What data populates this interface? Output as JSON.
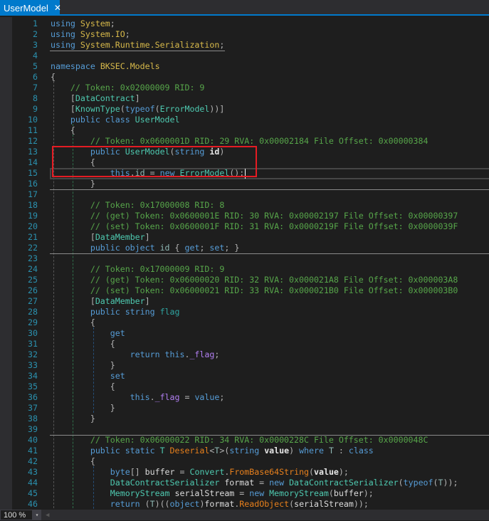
{
  "tab": {
    "title": "UserModel",
    "close": "✕"
  },
  "status": {
    "zoom": "100 %",
    "dropdown": "▾",
    "scroll_left": "◀"
  },
  "colors": {
    "accent": "#007acc",
    "highlight_box": "#e51c23"
  },
  "lines": [
    [
      [
        "kw",
        "using"
      ],
      [
        "lo",
        " "
      ],
      [
        "ns",
        "System"
      ],
      [
        "p",
        ";"
      ]
    ],
    [
      [
        "kw",
        "using"
      ],
      [
        "lo",
        " "
      ],
      [
        "ns",
        "System.IO"
      ],
      [
        "p",
        ";"
      ]
    ],
    [
      [
        "kw",
        "using"
      ],
      [
        "lo",
        " "
      ],
      [
        "ns",
        "System.Runtime.Serialization"
      ],
      [
        "p",
        ";"
      ]
    ],
    [],
    [
      [
        "kw",
        "namespace"
      ],
      [
        "lo",
        " "
      ],
      [
        "ns",
        "BKSEC.Models"
      ]
    ],
    [
      [
        "p",
        "{"
      ]
    ],
    [
      [
        "cm",
        "    // Token: 0x02000009 RID: 9"
      ]
    ],
    [
      [
        "p",
        "    ["
      ],
      [
        "ty",
        "DataContract"
      ],
      [
        "p",
        "]"
      ]
    ],
    [
      [
        "p",
        "    ["
      ],
      [
        "ty",
        "KnownType"
      ],
      [
        "p",
        "("
      ],
      [
        "kw",
        "typeof"
      ],
      [
        "p",
        "("
      ],
      [
        "ty",
        "ErrorModel"
      ],
      [
        "p",
        "))]"
      ]
    ],
    [
      [
        "kw",
        "    public class "
      ],
      [
        "ty",
        "UserModel"
      ]
    ],
    [
      [
        "p",
        "    {"
      ]
    ],
    [
      [
        "cm",
        "        // Token: 0x0600001D RID: 29 RVA: 0x00002184 File Offset: 0x00000384"
      ]
    ],
    [
      [
        "kw",
        "        public "
      ],
      [
        "ty",
        "UserModel"
      ],
      [
        "p",
        "("
      ],
      [
        "kw",
        "string "
      ],
      [
        "pa",
        "id"
      ],
      [
        "p",
        ")"
      ]
    ],
    [
      [
        "p",
        "        {"
      ]
    ],
    [
      [
        "kw",
        "            this"
      ],
      [
        "p",
        "."
      ],
      [
        "pr",
        "id"
      ],
      [
        "p",
        " = "
      ],
      [
        "kw",
        "new "
      ],
      [
        "ty",
        "ErrorModel"
      ],
      [
        "p",
        "();"
      ]
    ],
    [
      [
        "p",
        "        }"
      ]
    ],
    [],
    [
      [
        "cm",
        "        // Token: 0x17000008 RID: 8"
      ]
    ],
    [
      [
        "cm",
        "        // (get) Token: 0x0600001E RID: 30 RVA: 0x00002197 File Offset: 0x00000397"
      ]
    ],
    [
      [
        "cm",
        "        // (set) Token: 0x0600001F RID: 31 RVA: 0x0000219F File Offset: 0x0000039F"
      ]
    ],
    [
      [
        "p",
        "        ["
      ],
      [
        "ty",
        "DataMember"
      ],
      [
        "p",
        "]"
      ]
    ],
    [
      [
        "kw",
        "        public object "
      ],
      [
        "pr",
        "id"
      ],
      [
        "p",
        " { "
      ],
      [
        "kw",
        "get"
      ],
      [
        "p",
        "; "
      ],
      [
        "kw",
        "set"
      ],
      [
        "p",
        "; }"
      ]
    ],
    [],
    [
      [
        "cm",
        "        // Token: 0x17000009 RID: 9"
      ]
    ],
    [
      [
        "cm",
        "        // (get) Token: 0x06000020 RID: 32 RVA: 0x000021A8 File Offset: 0x000003A8"
      ]
    ],
    [
      [
        "cm",
        "        // (set) Token: 0x06000021 RID: 33 RVA: 0x000021B0 File Offset: 0x000003B0"
      ]
    ],
    [
      [
        "p",
        "        ["
      ],
      [
        "ty",
        "DataMember"
      ],
      [
        "p",
        "]"
      ]
    ],
    [
      [
        "kw",
        "        public string "
      ],
      [
        "pf",
        "flag"
      ]
    ],
    [
      [
        "p",
        "        {"
      ]
    ],
    [
      [
        "kw",
        "            get"
      ]
    ],
    [
      [
        "p",
        "            {"
      ]
    ],
    [
      [
        "kw",
        "                return this"
      ],
      [
        "p",
        "."
      ],
      [
        "fi",
        "_flag"
      ],
      [
        "p",
        ";"
      ]
    ],
    [
      [
        "p",
        "            }"
      ]
    ],
    [
      [
        "kw",
        "            set"
      ]
    ],
    [
      [
        "p",
        "            {"
      ]
    ],
    [
      [
        "kw",
        "                this"
      ],
      [
        "p",
        "."
      ],
      [
        "fi",
        "_flag"
      ],
      [
        "p",
        " = "
      ],
      [
        "kw",
        "value"
      ],
      [
        "p",
        ";"
      ]
    ],
    [
      [
        "p",
        "            }"
      ]
    ],
    [
      [
        "p",
        "        }"
      ]
    ],
    [],
    [
      [
        "cm",
        "        // Token: 0x06000022 RID: 34 RVA: 0x0000228C File Offset: 0x0000048C"
      ]
    ],
    [
      [
        "kw",
        "        public static "
      ],
      [
        "ty",
        "T "
      ],
      [
        "me",
        "Deserial"
      ],
      [
        "p",
        "<"
      ],
      [
        "gp",
        "T"
      ],
      [
        "p",
        ">("
      ],
      [
        "kw",
        "string "
      ],
      [
        "pa",
        "value"
      ],
      [
        "p",
        ") "
      ],
      [
        "kw",
        "where "
      ],
      [
        "gp",
        "T"
      ],
      [
        "p",
        " : "
      ],
      [
        "kw",
        "class"
      ]
    ],
    [
      [
        "p",
        "        {"
      ]
    ],
    [
      [
        "kw",
        "            byte"
      ],
      [
        "p",
        "[] "
      ],
      [
        "lo",
        "buffer"
      ],
      [
        "p",
        " = "
      ],
      [
        "ty",
        "Convert"
      ],
      [
        "p",
        "."
      ],
      [
        "me",
        "FromBase64String"
      ],
      [
        "p",
        "("
      ],
      [
        "pa",
        "value"
      ],
      [
        "p",
        ");"
      ]
    ],
    [
      [
        "ty",
        "            DataContractSerializer "
      ],
      [
        "lo",
        "format"
      ],
      [
        "p",
        " = "
      ],
      [
        "kw",
        "new "
      ],
      [
        "ty",
        "DataContractSerializer"
      ],
      [
        "p",
        "("
      ],
      [
        "kw",
        "typeof"
      ],
      [
        "p",
        "("
      ],
      [
        "gp",
        "T"
      ],
      [
        "p",
        "));"
      ]
    ],
    [
      [
        "ty",
        "            MemoryStream "
      ],
      [
        "lo",
        "serialStream"
      ],
      [
        "p",
        " = "
      ],
      [
        "kw",
        "new "
      ],
      [
        "ty",
        "MemoryStream"
      ],
      [
        "p",
        "("
      ],
      [
        "lo",
        "buffer"
      ],
      [
        "p",
        ");"
      ]
    ],
    [
      [
        "kw",
        "            return "
      ],
      [
        "p",
        "("
      ],
      [
        "gp",
        "T"
      ],
      [
        "p",
        ")(("
      ],
      [
        "kw",
        "object"
      ],
      [
        "p",
        ")"
      ],
      [
        "lo",
        "format"
      ],
      [
        "p",
        "."
      ],
      [
        "me",
        "ReadObject"
      ],
      [
        "p",
        "("
      ],
      [
        "lo",
        "serialStream"
      ],
      [
        "p",
        "));"
      ]
    ],
    []
  ]
}
